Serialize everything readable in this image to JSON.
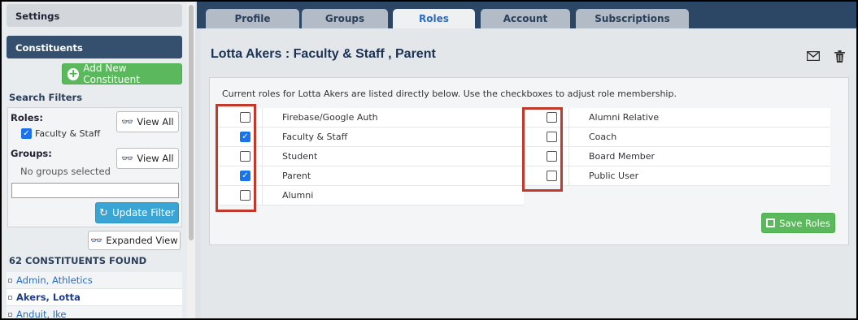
{
  "sidebar": {
    "settings": "Settings",
    "constituents": "Constituents",
    "add_button": "Add New Constituent",
    "filters_heading": "Search Filters",
    "roles_label": "Roles:",
    "role_filter_value": "Faculty & Staff",
    "view_all": "View All",
    "groups_label": "Groups:",
    "no_groups": "No groups selected",
    "update_button": "Update Filter",
    "expanded_button": "Expanded View",
    "found_text": "62 CONSTITUENTS FOUND",
    "results": [
      "Admin, Athletics",
      "Akers, Lotta",
      "Anduit, Ike"
    ]
  },
  "tabs": [
    "Profile",
    "Groups",
    "Roles",
    "Account",
    "Subscriptions"
  ],
  "active_tab": "Roles",
  "page_title": "Lotta Akers : Faculty & Staff , Parent",
  "instructions": "Current roles for Lotta Akers are listed directly below. Use the checkboxes to adjust role membership.",
  "roles_left": [
    {
      "label": "Firebase/Google Auth",
      "checked": false
    },
    {
      "label": "Faculty & Staff",
      "checked": true
    },
    {
      "label": "Student",
      "checked": false
    },
    {
      "label": "Parent",
      "checked": true
    },
    {
      "label": "Alumni",
      "checked": false
    }
  ],
  "roles_right": [
    {
      "label": "Alumni Relative",
      "checked": false
    },
    {
      "label": "Coach",
      "checked": false
    },
    {
      "label": "Board Member",
      "checked": false
    },
    {
      "label": "Public User",
      "checked": false
    }
  ],
  "save_button": "Save Roles",
  "colors": {
    "accent": "#2c4766",
    "highlight": "#c0392b",
    "success": "#5cb85c",
    "checkbox": "#1a73e8"
  },
  "icons": [
    "plus-circle-icon",
    "glasses-icon",
    "refresh-icon",
    "envelope-icon",
    "trash-icon",
    "save-icon"
  ]
}
